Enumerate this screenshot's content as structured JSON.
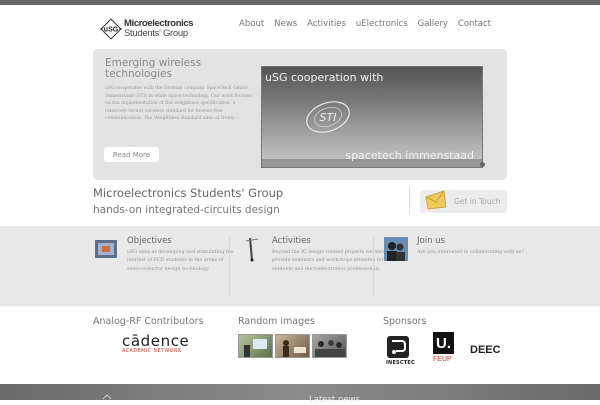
{
  "header": {
    "logo_line1": "Microelectronics",
    "logo_line2": "Students' Group",
    "logo_mark_text": "uSG",
    "nav": [
      "About",
      "News",
      "Activities",
      "uElectronics",
      "Gallery",
      "Contact"
    ]
  },
  "banner": {
    "title": "Emerging wireless technologies",
    "text": "uSG cooperates with the German company SpaceTech GmbH Immenstaad (STI) in while space technology. Our work focuses on the implementation of the weightless specification, a relatively recent wireless standard for license-free communication. The Weightless standard aims at freely...",
    "read_more": "Read More",
    "image_top_text": "uSG cooperation with",
    "image_bottom_text": "spacetech immenstaad",
    "image_logo_text": "STI"
  },
  "intro": {
    "title": "Microelectronics Students' Group",
    "subtitle": "hands-on integrated-circuits design",
    "cta": "Get in Touch"
  },
  "columns": [
    {
      "title": "Objectives",
      "text": "uSG aims at developing and stimulating the interest of ECE students in the areas of semiconductor design technology.",
      "icon": "chip-icon"
    },
    {
      "title": "Activities",
      "text": "Beyond the IC design related projects we also provide seminars and workshops intended for students and microelectronics professionals.",
      "icon": "probe-icon"
    },
    {
      "title": "Join us",
      "text": "Are you interested in collaborating with us?",
      "icon": "people-icon"
    }
  ],
  "bottom": {
    "contributors_title": "Analog-RF Contributors",
    "cadence_word": "cādence",
    "cadence_sub": "ACADEMIC NETWORK",
    "random_title": "Random images",
    "sponsors_title": "Sponsors",
    "sponsor_inesc": "INESCTEC",
    "sponsor_feup_mark": "U.",
    "sponsor_feup": "FEUP",
    "sponsor_deec": "DEEC"
  },
  "footer": {
    "title": "Latest news"
  },
  "colors": {
    "banner_bg": "#e3e3e3",
    "band_bg": "#e8e8e8",
    "accent_red": "#c0392b",
    "topbar": "#666666"
  }
}
